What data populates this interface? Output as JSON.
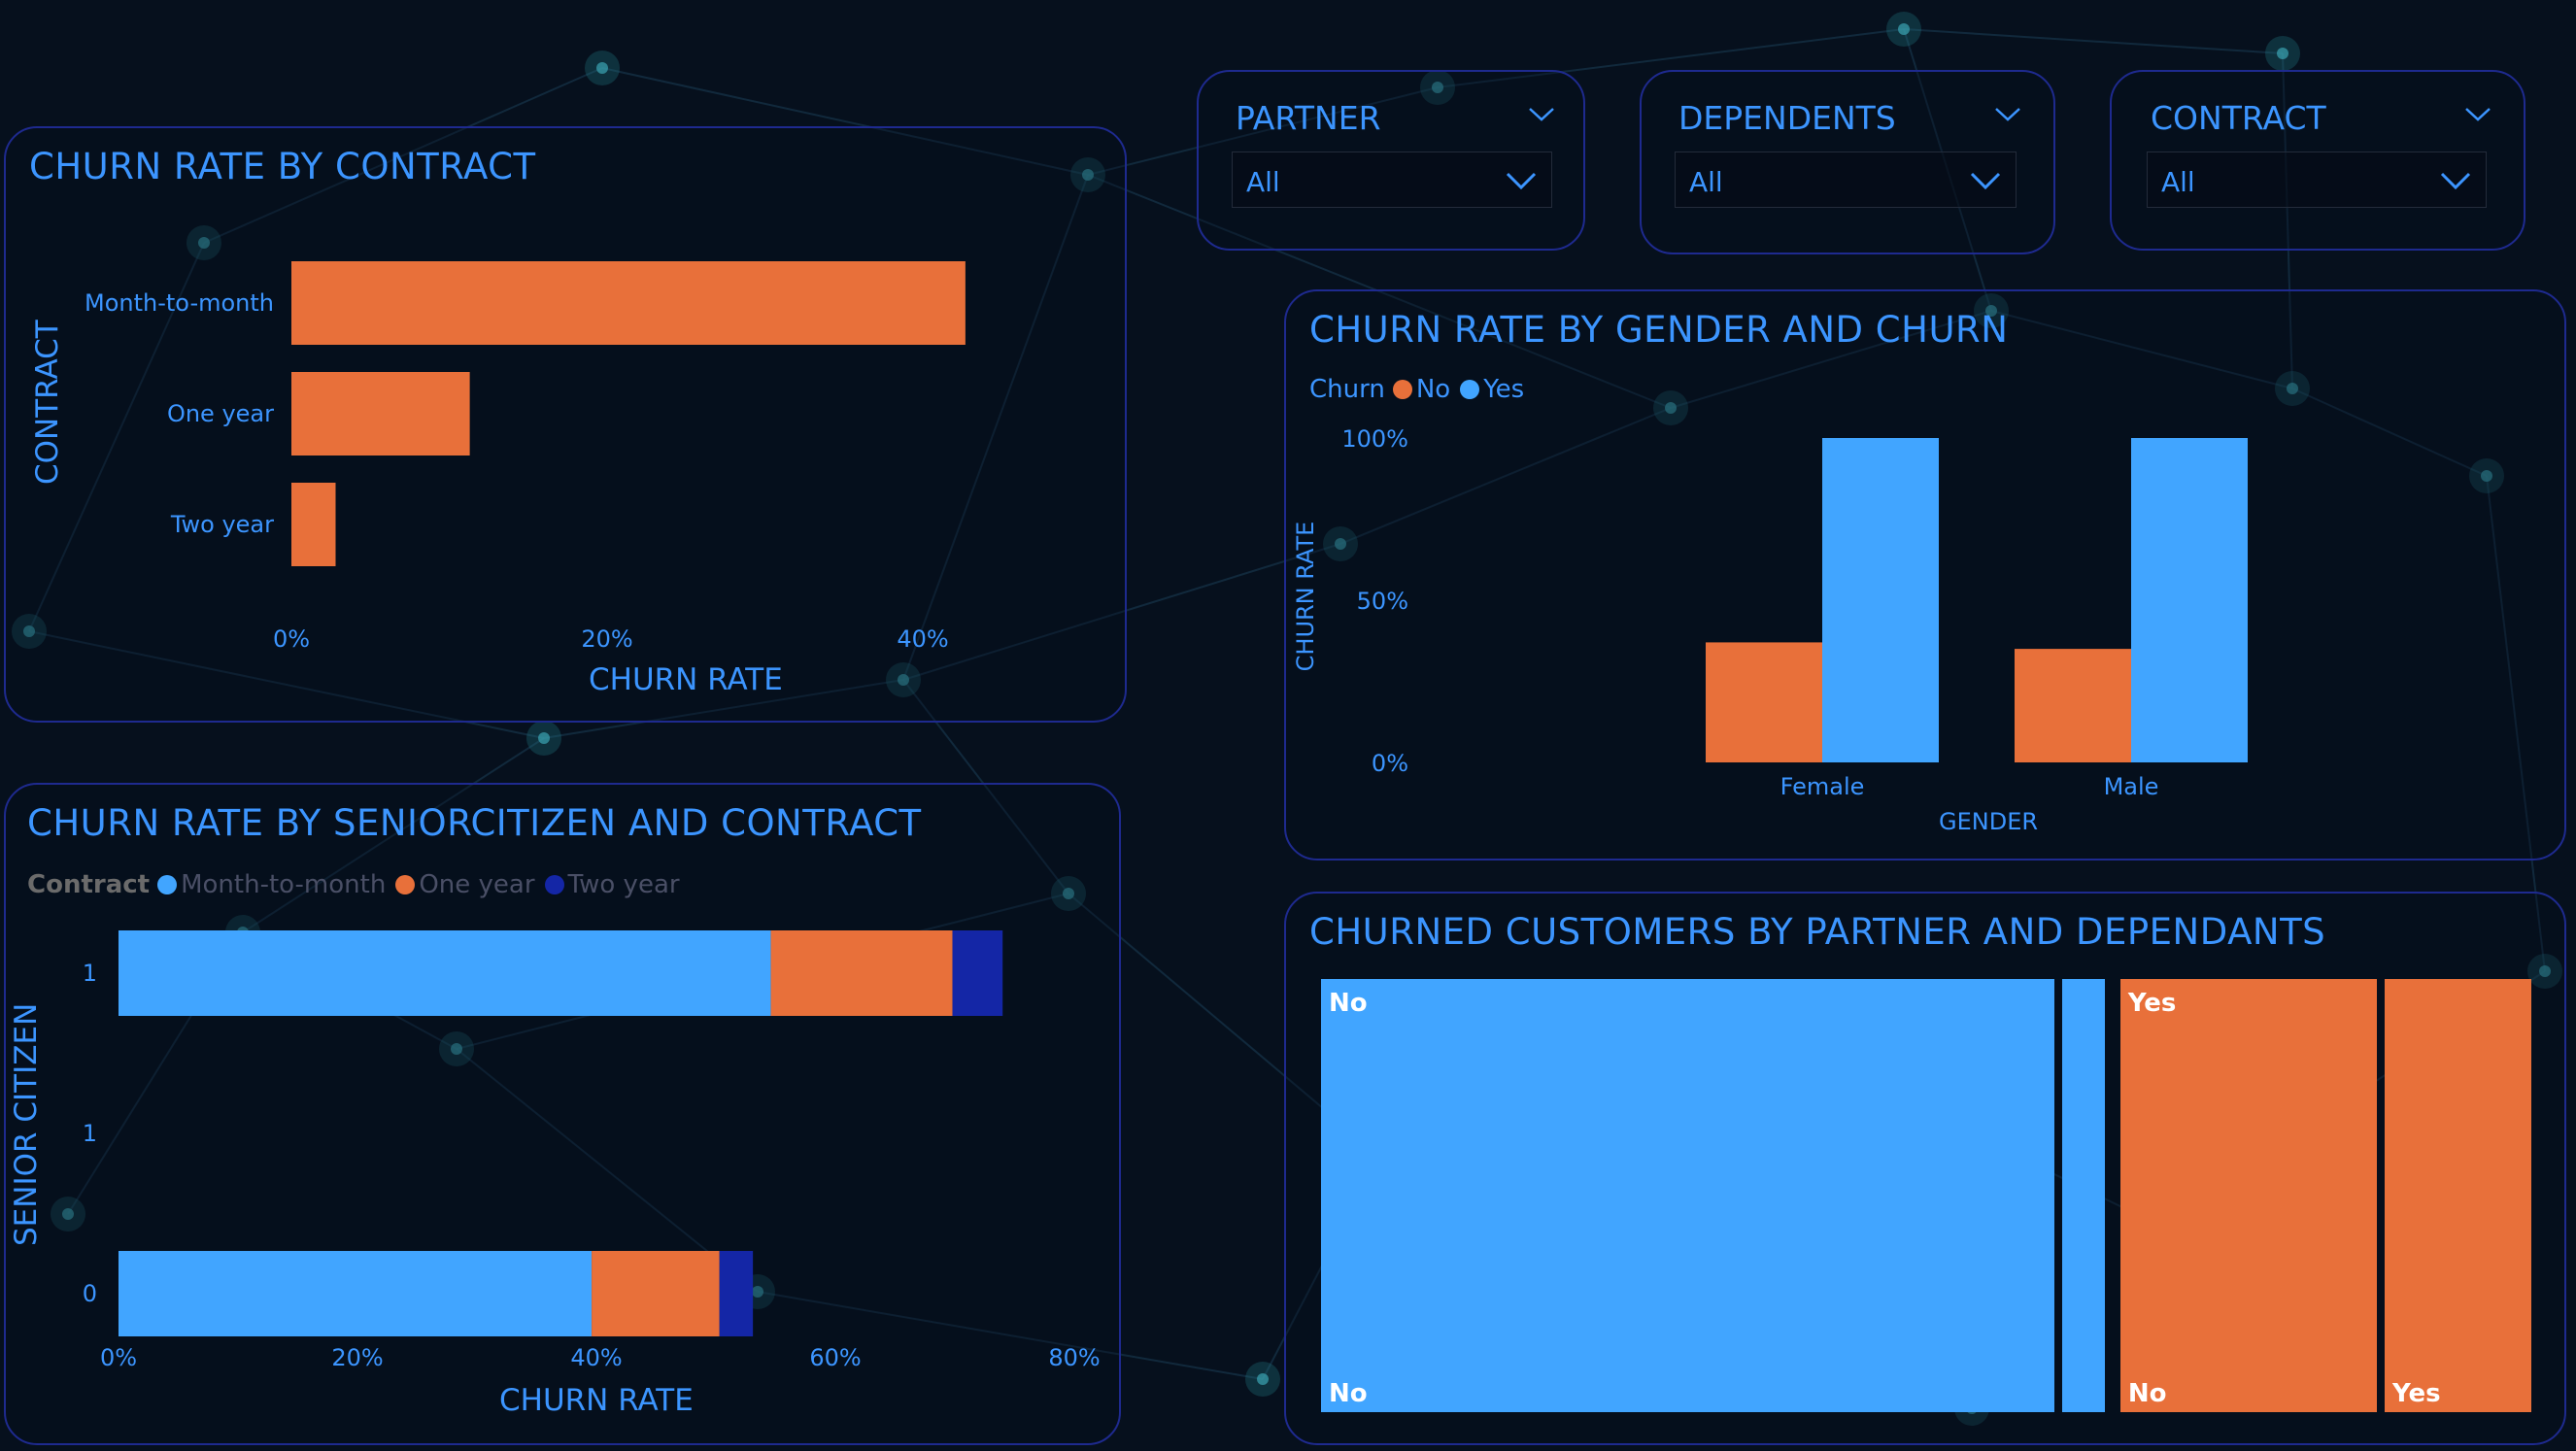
{
  "colors": {
    "orange": "#e8703a",
    "blue": "#41a5ff",
    "dark_blue": "#1426a6",
    "title": "#3c95ff"
  },
  "slicers": [
    {
      "title": "PARTNER",
      "value": "All"
    },
    {
      "title": "DEPENDENTS",
      "value": "All"
    },
    {
      "title": "CONTRACT",
      "value": "All"
    }
  ],
  "contract_chart": {
    "title": "CHURN RATE BY CONTRACT",
    "y_title": "CONTRACT",
    "x_title": "CHURN RATE",
    "x_ticks": [
      "0%",
      "20%",
      "40%"
    ]
  },
  "gender_chart": {
    "title": "CHURN RATE BY GENDER AND CHURN",
    "legend_title": "Churn",
    "y_title": "CHURN RATE",
    "x_title": "GENDER",
    "y_ticks": [
      "100%",
      "50%",
      "0%"
    ]
  },
  "senior_chart": {
    "title": "CHURN RATE BY SENIORCITIZEN AND CONTRACT",
    "legend_title": "Contract",
    "y_title": "SENIOR CITIZEN",
    "x_title": "CHURN RATE",
    "x_ticks": [
      "0%",
      "20%",
      "40%",
      "60%",
      "80%"
    ]
  },
  "treemap": {
    "title": "CHURNED CUSTOMERS BY PARTNER AND DEPENDANTS",
    "groups": [
      {
        "label": "No",
        "color": "#41a5ff",
        "children": [
          {
            "label": "No",
            "value": 1200
          },
          {
            "label": "",
            "value": 70
          }
        ]
      },
      {
        "label": "Yes",
        "color": "#e8703a",
        "children": [
          {
            "label": "No",
            "value": 420
          },
          {
            "label": "Yes",
            "value": 240
          }
        ]
      }
    ]
  },
  "chart_data": [
    {
      "type": "bar",
      "orientation": "horizontal",
      "title": "CHURN RATE BY CONTRACT",
      "xlabel": "CHURN RATE",
      "ylabel": "CONTRACT",
      "categories": [
        "Month-to-month",
        "One year",
        "Two year"
      ],
      "values": [
        42.7,
        11.3,
        2.8
      ],
      "xlim": [
        0,
        45
      ],
      "unit": "%",
      "color": "#e8703a"
    },
    {
      "type": "bar",
      "title": "CHURN RATE BY GENDER AND CHURN",
      "xlabel": "GENDER",
      "ylabel": "CHURN RATE",
      "categories": [
        "Female",
        "Male"
      ],
      "series": [
        {
          "name": "No",
          "color": "#e8703a",
          "values": [
            37,
            35
          ]
        },
        {
          "name": "Yes",
          "color": "#41a5ff",
          "values": [
            100,
            100
          ]
        }
      ],
      "ylim": [
        0,
        100
      ],
      "unit": "%"
    },
    {
      "type": "bar",
      "orientation": "horizontal",
      "stacked": true,
      "title": "CHURN RATE BY SENIORCITIZEN AND CONTRACT",
      "xlabel": "CHURN RATE",
      "ylabel": "SENIOR CITIZEN",
      "categories": [
        "1",
        "1",
        "0"
      ],
      "series": [
        {
          "name": "Month-to-month",
          "color": "#41a5ff",
          "values": [
            54.6,
            0,
            39.6
          ]
        },
        {
          "name": "One year",
          "color": "#e8703a",
          "values": [
            15.2,
            0,
            10.7
          ]
        },
        {
          "name": "Two year",
          "color": "#1426a6",
          "values": [
            4.2,
            0,
            2.8
          ]
        }
      ],
      "xlim": [
        0,
        80
      ],
      "unit": "%"
    }
  ]
}
